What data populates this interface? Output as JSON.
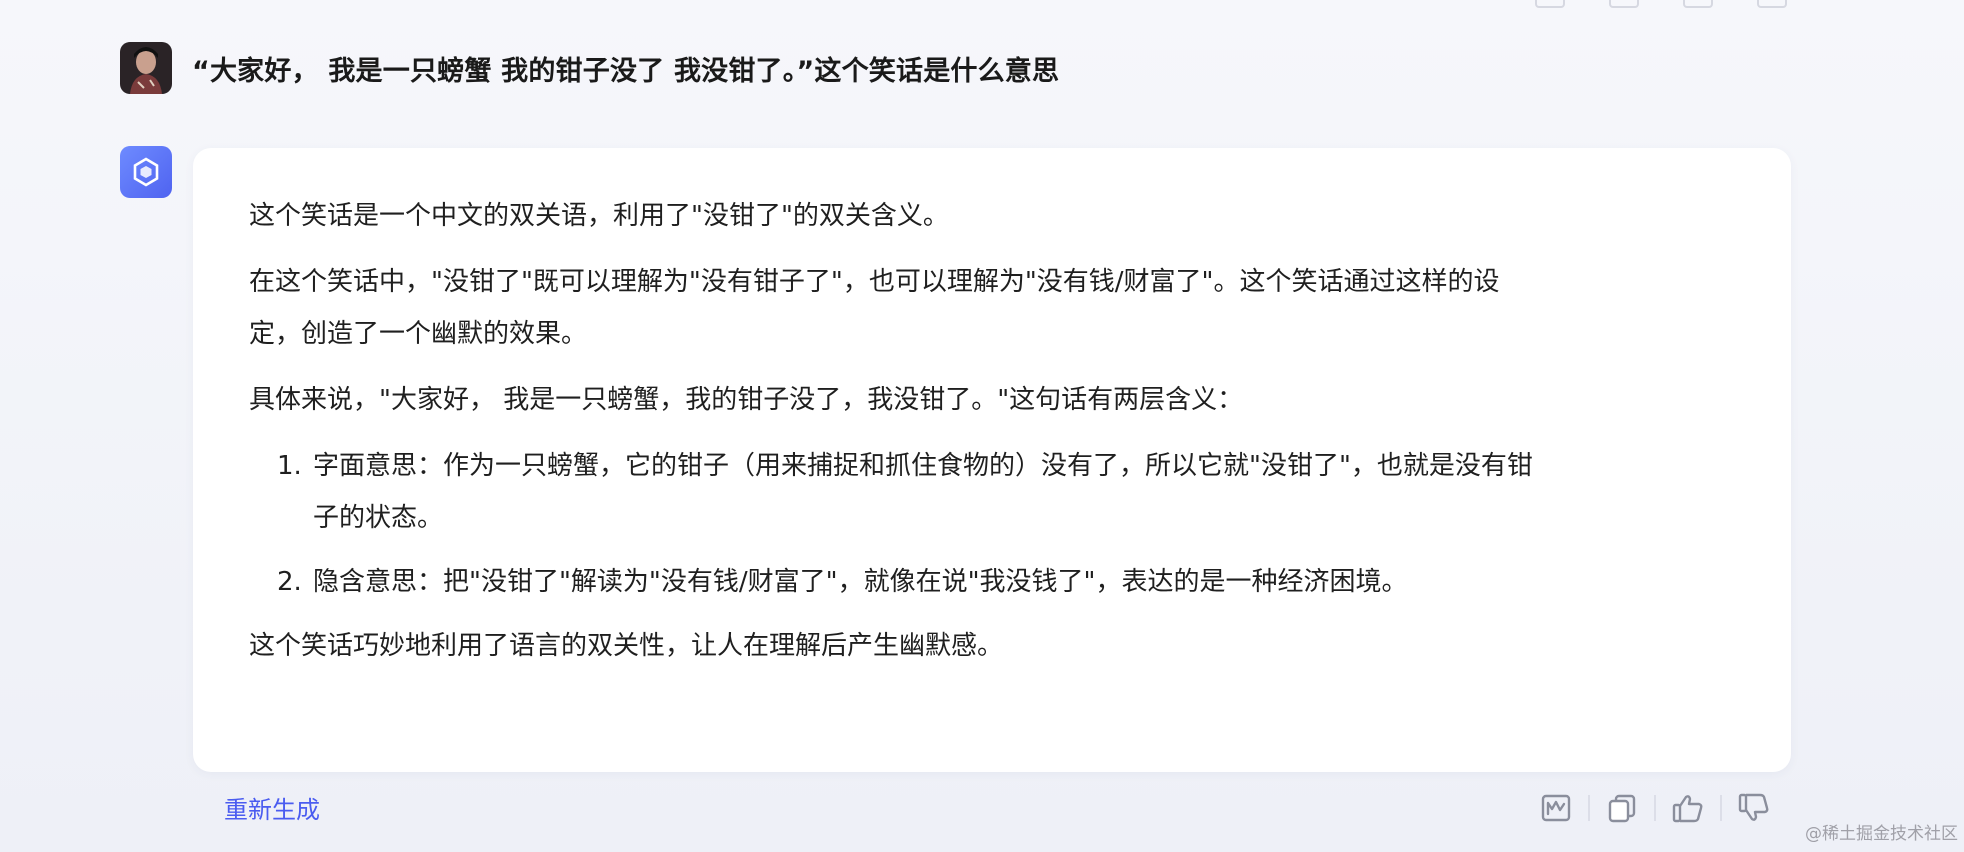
{
  "conversation": {
    "user_message": "“大家好， 我是一只螃蟹 我的钳子没了 我没钳了。”这个笑话是什么意思",
    "answer": {
      "intro": "这个笑话是一个中文的双关语，利用了\"没钳了\"的双关含义。",
      "explanation_line1": "在这个笑话中，\"没钳了\"既可以理解为\"没有钳子了\"，也可以理解为\"没有钱/财富了\"。这个笑话通过这样的设",
      "explanation_line2": "定，创造了一个幽默的效果。",
      "detail": "具体来说，\"大家好， 我是一只螃蟹，我的钳子没了，我没钳了。\"这句话有两层含义：",
      "points": [
        {
          "number": "1.",
          "line1": "字面意思：作为一只螃蟹，它的钳子（用来捕捉和抓住食物的）没有了，所以它就\"没钳了\"，也就是没有钳",
          "line2": "子的状态。"
        },
        {
          "number": "2.",
          "line1": "隐含意思：把\"没钳了\"解读为\"没有钱/财富了\"，就像在说\"我没钱了\"，表达的是一种经济困境。"
        }
      ],
      "conclusion": "这个笑话巧妙地利用了语言的双关性，让人在理解后产生幽默感。"
    }
  },
  "actions": {
    "regenerate_label": "重新生成",
    "icons": [
      "summary-icon",
      "copy-icon",
      "thumbs-up-icon",
      "thumbs-down-icon"
    ]
  },
  "watermark": "@稀土掘金技术社区",
  "colors": {
    "accent": "#4a5cf0",
    "card": "#ffffff",
    "icon": "#8a8e9c"
  }
}
